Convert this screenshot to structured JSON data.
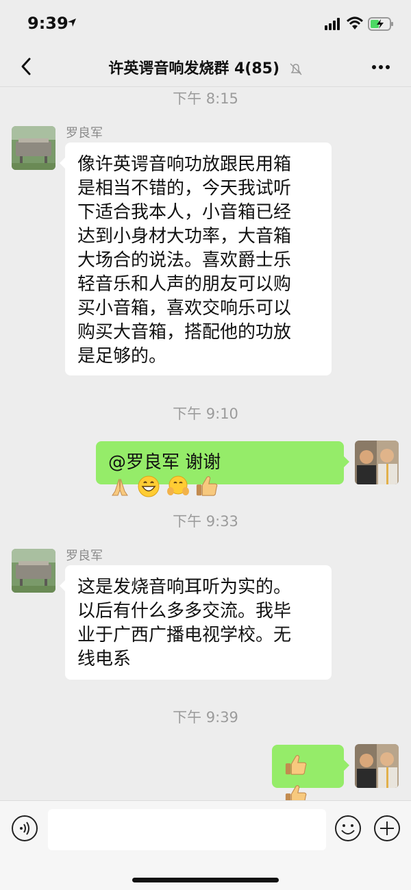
{
  "status_bar": {
    "time": "9:39"
  },
  "header": {
    "title": "许英谔音响发烧群 4(85)"
  },
  "messages": {
    "ts1": "下午 8:15",
    "msg1": {
      "sender": "罗良军",
      "lines": [
        "像许英谔音响功放跟民用箱",
        "是相当不错的，今天我试听",
        "下适合我本人，小音箱已经",
        "达到小身材大功率，大音箱",
        "大场合的说法。喜欢爵士乐",
        "轻音乐和人声的朋友可以购",
        "买小音箱，喜欢交响乐可以",
        "购买大音箱，搭配他的功放",
        "是足够的。"
      ]
    },
    "ts2": "下午 9:10",
    "msg2": {
      "text": "@罗良军 谢谢",
      "emojis": [
        "folded-hands-emoji",
        "grinning-emoji",
        "hugging-emoji",
        "thumbs-up-emoji"
      ]
    },
    "ts3": "下午 9:33",
    "msg3": {
      "sender": "罗良军",
      "lines": [
        "这是发烧音响耳听为实的。",
        "以后有什么多多交流。我毕",
        "业于广西广播电视学校。无",
        "线电系"
      ]
    },
    "ts4": "下午 9:39",
    "msg4": {
      "emojis": [
        "thumbs-up-emoji",
        "thumbs-up-emoji"
      ]
    }
  },
  "input_bar": {
    "placeholder": ""
  },
  "colors": {
    "bg": "#ededed",
    "green_bubble": "#95ec69",
    "white_bubble": "#ffffff",
    "timestamp": "#9b9b9b"
  }
}
